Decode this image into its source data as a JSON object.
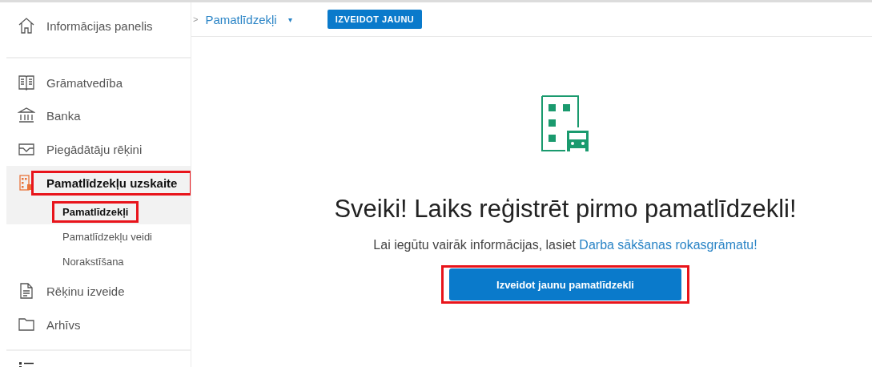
{
  "sidebar": {
    "top_item": {
      "label": "Informācijas panelis",
      "kind": "home"
    },
    "items": [
      {
        "label": "Grāmatvedība",
        "kind": "book",
        "selected": false,
        "highlighted": false
      },
      {
        "label": "Banka",
        "kind": "bank",
        "selected": false,
        "highlighted": false
      },
      {
        "label": "Piegādātāju rēķini",
        "kind": "inbox",
        "selected": false,
        "highlighted": false
      },
      {
        "label": "Pamatlīdzekļu uzskaite",
        "kind": "assets",
        "selected": true,
        "highlighted": true,
        "children": [
          {
            "label": "Pamatlīdzekļi",
            "selected": true,
            "highlighted": true
          },
          {
            "label": "Pamatlīdzekļu veidi",
            "selected": false,
            "highlighted": false
          },
          {
            "label": "Norakstīšana",
            "selected": false,
            "highlighted": false
          }
        ]
      },
      {
        "label": "Rēķinu izveide",
        "kind": "document",
        "selected": false,
        "highlighted": false
      },
      {
        "label": "Arhīvs",
        "kind": "folder",
        "selected": false,
        "highlighted": false
      }
    ],
    "bottom_item": {
      "kind": "list"
    }
  },
  "header": {
    "separator": ">",
    "breadcrumb": "Pamatlīdzekļi",
    "dropdown_caret": "▾",
    "button": "IZVEIDOT JAUNU"
  },
  "empty_state": {
    "heading": "Sveiki! Laiks reģistrēt pirmo pamatlīdzekli!",
    "text": "Lai iegūtu vairāk informācijas, lasiet",
    "link": "Darba sākšanas rokasgrāmatu!",
    "button": "Izveidot jaunu pamatlīdzekli",
    "button_highlighted": true
  }
}
